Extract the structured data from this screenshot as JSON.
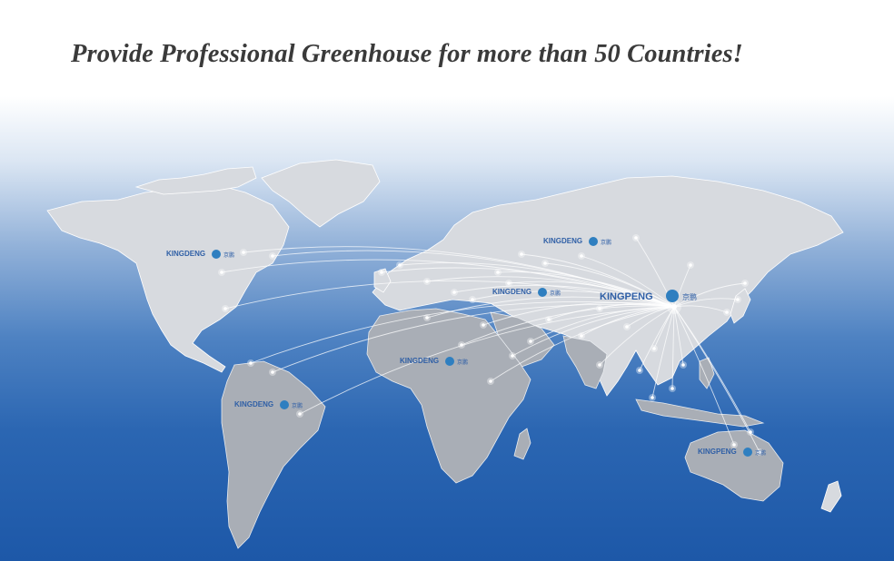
{
  "headline": "Provide Professional Greenhouse for more than 50 Countries!",
  "brand": {
    "name": "KINGPENG",
    "name_small": "KINGDENG",
    "chinese": "京鹏",
    "color": "#2f5fa6"
  },
  "colors": {
    "background_top": "#ffffff",
    "background_bottom": "#1d58a8",
    "land": "#d7dadf",
    "route": "#ffffff"
  },
  "map_labels": [
    {
      "id": "north-america",
      "text": "KINGDENG"
    },
    {
      "id": "russia",
      "text": "KINGDENG"
    },
    {
      "id": "middle-east",
      "text": "KINGDENG"
    },
    {
      "id": "china",
      "text": "KINGPENG"
    },
    {
      "id": "africa",
      "text": "KINGDENG"
    },
    {
      "id": "south-america",
      "text": "KINGDENG"
    },
    {
      "id": "australia",
      "text": "KINGPENG"
    }
  ]
}
